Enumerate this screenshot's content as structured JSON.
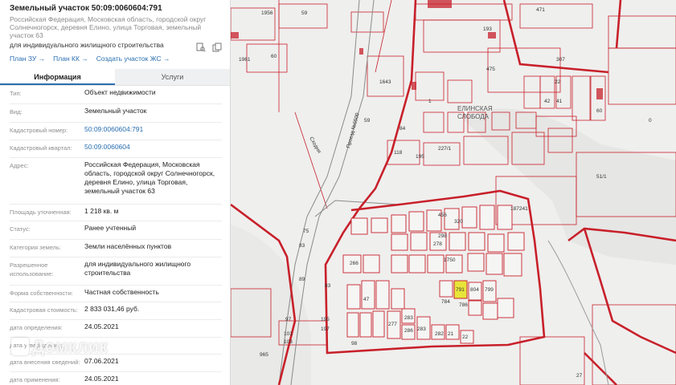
{
  "header": {
    "title": "Земельный участок 50:09:0060604:791",
    "address": "Российская Федерация, Московская область, городской округ Солнечногорск, деревня Елино, улица Торговая, земельный участок 63",
    "purpose": "для индивидуального жилищного строительства",
    "links": [
      "План ЗУ →",
      "План КК →",
      "Создать участок ЖС →"
    ]
  },
  "tabs": [
    "Информация",
    "Услуги"
  ],
  "info": [
    {
      "k": "Тип:",
      "v": "Объект недвижимости"
    },
    {
      "k": "Вид:",
      "v": "Земельный участок"
    },
    {
      "k": "Кадастровый номер:",
      "v": "50:09:0060604:791"
    },
    {
      "k": "Кадастровый квартал:",
      "v": "50:09:0060604"
    },
    {
      "k": "Адрес:",
      "v": "Российская Федерация, Московская область, городской округ Солнечногорск, деревня Елино, улица Торговая, земельный участок 63"
    },
    {
      "k": "Площадь уточненная:",
      "v": "1 218 кв. м"
    },
    {
      "k": "Статус:",
      "v": "Ранее учтенный"
    },
    {
      "k": "Категория земель:",
      "v": "Земли населённых пунктов"
    },
    {
      "k": "Разрешенное использование:",
      "v": "для индивидуального жилищного строительства"
    },
    {
      "k": "Форма собственности:",
      "v": "Частная собственность"
    },
    {
      "k": "Кадастровая стоимость:",
      "v": "2 833 031,46 руб."
    },
    {
      "k": "дата определения:",
      "v": "24.05.2021"
    },
    {
      "k": "дата утверждения:",
      "v": "-"
    },
    {
      "k": "дата внесения сведений:",
      "v": "07.06.2021"
    },
    {
      "k": "дата применения:",
      "v": "24.05.2021"
    }
  ],
  "watermark": "Домклик",
  "map": {
    "village_label": [
      "ЕЛИНСКАЯ",
      "СЛОБОДА"
    ],
    "road_label": "Проезд №6500",
    "river_label": "Сходня",
    "labels": [
      "1956",
      "59",
      "471",
      "193",
      "307",
      "1961",
      "60",
      "1643",
      "475",
      "22",
      "42",
      "41",
      "416",
      "413",
      "1",
      "88",
      "59",
      "84",
      "109",
      "2",
      "9",
      "130",
      "118",
      "195",
      "227/1",
      "5",
      "53",
      "51/1",
      "187241",
      "456",
      "320",
      "298",
      "278",
      "255",
      "266",
      "245",
      "264",
      "75",
      "83",
      "84",
      "1750",
      "99",
      "47",
      "174",
      "59",
      "106",
      "100",
      "154",
      "156",
      "116",
      "182",
      "150",
      "45",
      "44",
      "51",
      "46",
      "46",
      "791",
      "804",
      "799",
      "784",
      "786",
      "87",
      "24",
      "277",
      "283",
      "286",
      "283",
      "282",
      "21",
      "22",
      "210",
      "97",
      "101",
      "103",
      "965",
      "195",
      "197",
      "98"
    ],
    "colors": {
      "parcel": "#c8202a",
      "highlight": "#e8e53a"
    }
  }
}
